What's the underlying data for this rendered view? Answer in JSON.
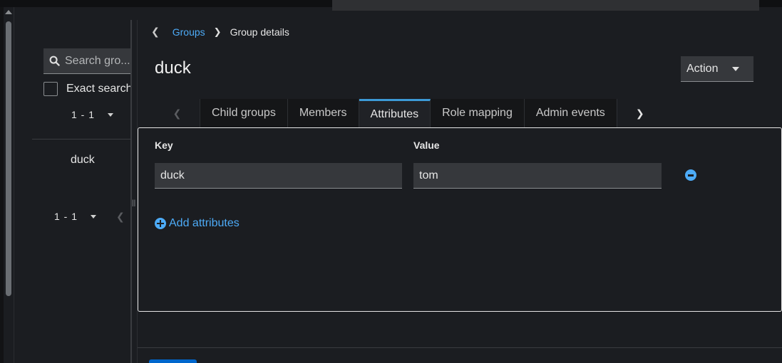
{
  "sidebar": {
    "search_placeholder": "Search gro...",
    "exact_search_label": "Exact search",
    "pagination_top": "1 - 1",
    "items": [
      {
        "label": "duck"
      }
    ],
    "pagination_bottom": "1 - 1"
  },
  "breadcrumb": {
    "back_icon": "chevron-left-icon",
    "link": "Groups",
    "current": "Group details"
  },
  "page": {
    "title": "duck",
    "action_label": "Action"
  },
  "tabs": [
    {
      "label": "Child groups",
      "active": false
    },
    {
      "label": "Members",
      "active": false
    },
    {
      "label": "Attributes",
      "active": true
    },
    {
      "label": "Role mapping",
      "active": false
    },
    {
      "label": "Admin events",
      "active": false
    }
  ],
  "attributes": {
    "key_header": "Key",
    "value_header": "Value",
    "rows": [
      {
        "key": "duck",
        "value": "tom"
      }
    ],
    "add_label": "Add attributes"
  },
  "colors": {
    "accent": "#4dabf7",
    "active_tab_border": "#3c9ad6",
    "background": "#1b1d21"
  }
}
